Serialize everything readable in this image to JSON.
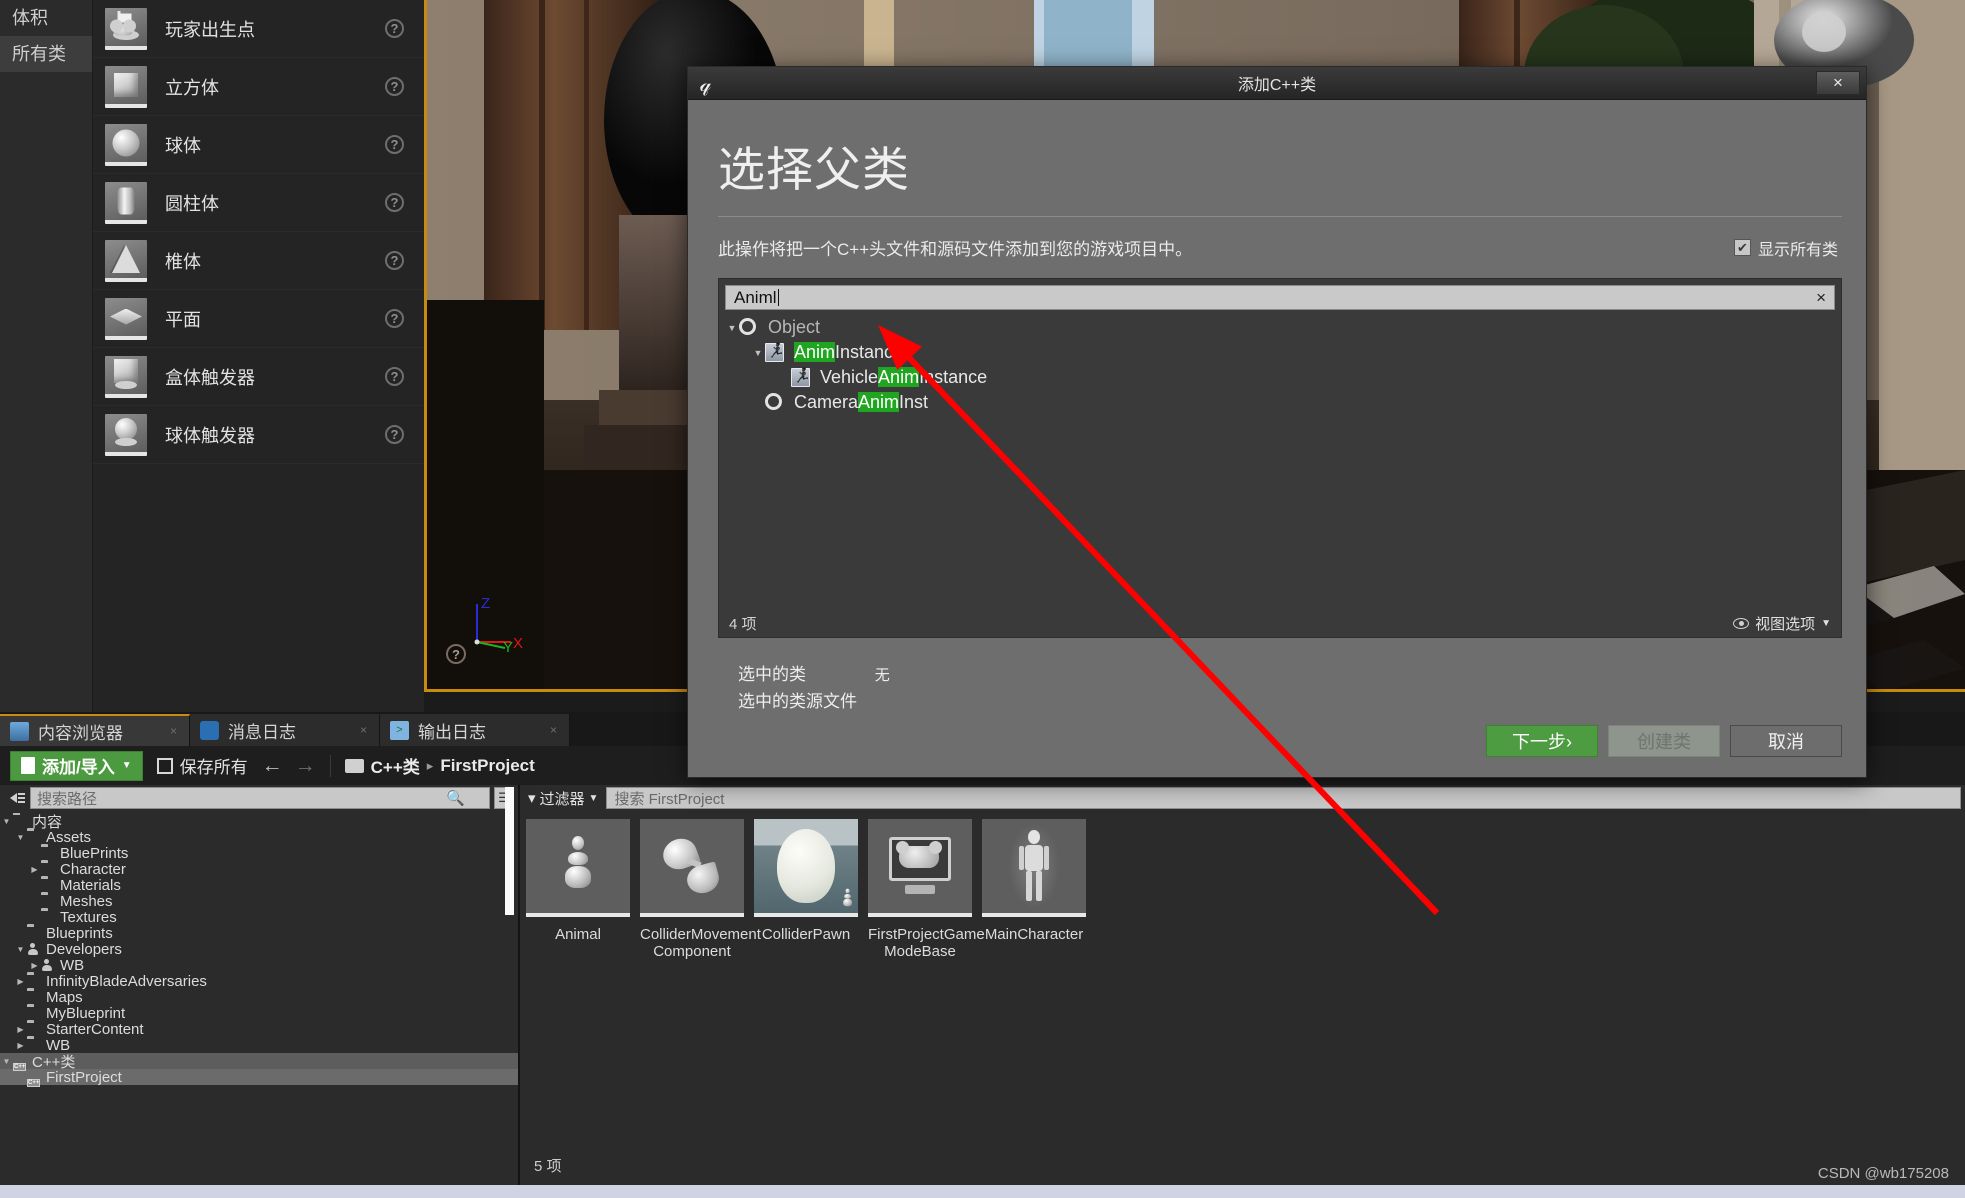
{
  "place_panel": {
    "categories": [
      {
        "label": "体积",
        "selected": false
      },
      {
        "label": "所有类",
        "selected": true
      }
    ],
    "items": [
      {
        "label": "玩家出生点",
        "icon": "player-start-icon",
        "help": "?"
      },
      {
        "label": "立方体",
        "icon": "cube-icon",
        "help": "?"
      },
      {
        "label": "球体",
        "icon": "sphere-icon",
        "help": "?"
      },
      {
        "label": "圆柱体",
        "icon": "cylinder-icon",
        "help": "?"
      },
      {
        "label": "椎体",
        "icon": "cone-icon",
        "help": "?"
      },
      {
        "label": "平面",
        "icon": "plane-icon",
        "help": "?"
      },
      {
        "label": "盒体触发器",
        "icon": "box-trigger-icon",
        "help": "?"
      },
      {
        "label": "球体触发器",
        "icon": "sphere-trigger-icon",
        "help": "?"
      }
    ]
  },
  "viewport": {
    "gizmo": {
      "z": "Z",
      "y": "Y",
      "x": "X",
      "z_color": "#2b2bd8",
      "y_color": "#1fb21f",
      "x_color": "#e01515"
    },
    "help_icon": "?",
    "focus_border_color": "#c98a10"
  },
  "content_browser": {
    "tabs": [
      {
        "label": "内容浏览器",
        "icon": "content-browser-icon",
        "active": true,
        "close": "×"
      },
      {
        "label": "消息日志",
        "icon": "message-log-icon",
        "active": false,
        "close": "×"
      },
      {
        "label": "输出日志",
        "icon": "output-log-icon",
        "active": false,
        "close": "×"
      }
    ],
    "toolbar": {
      "add_import_label": "添加/导入",
      "add_import_caret": "▼",
      "save_all_label": "保存所有",
      "back_arrow": "←",
      "forward_arrow": "→",
      "breadcrumb": [
        "C++类",
        "FirstProject"
      ],
      "breadcrumb_separator": "▸"
    },
    "path_panel": {
      "search_placeholder": "搜索路径",
      "search_icon": "magnifier-icon",
      "options_icon": "list-options-icon",
      "collapse_icon": "collapse-tree-icon",
      "tree": [
        {
          "label": "内容",
          "depth": 0,
          "arrow": "down",
          "icon": "folder-open",
          "sel": false
        },
        {
          "label": "Assets",
          "depth": 1,
          "arrow": "down",
          "icon": "folder-open",
          "sel": false
        },
        {
          "label": "BluePrints",
          "depth": 2,
          "arrow": "none",
          "icon": "folder",
          "sel": false
        },
        {
          "label": "Character",
          "depth": 2,
          "arrow": "right",
          "icon": "folder",
          "sel": false
        },
        {
          "label": "Materials",
          "depth": 2,
          "arrow": "none",
          "icon": "folder",
          "sel": false
        },
        {
          "label": "Meshes",
          "depth": 2,
          "arrow": "none",
          "icon": "folder",
          "sel": false
        },
        {
          "label": "Textures",
          "depth": 2,
          "arrow": "none",
          "icon": "folder",
          "sel": false
        },
        {
          "label": "Blueprints",
          "depth": 1,
          "arrow": "none",
          "icon": "folder",
          "sel": false
        },
        {
          "label": "Developers",
          "depth": 1,
          "arrow": "down",
          "icon": "user",
          "sel": false
        },
        {
          "label": "WB",
          "depth": 2,
          "arrow": "right",
          "icon": "user",
          "sel": false
        },
        {
          "label": "InfinityBladeAdversaries",
          "depth": 1,
          "arrow": "right",
          "icon": "folder",
          "sel": false
        },
        {
          "label": "Maps",
          "depth": 1,
          "arrow": "none",
          "icon": "folder",
          "sel": false
        },
        {
          "label": "MyBlueprint",
          "depth": 1,
          "arrow": "none",
          "icon": "folder",
          "sel": false
        },
        {
          "label": "StarterContent",
          "depth": 1,
          "arrow": "right",
          "icon": "folder",
          "sel": false
        },
        {
          "label": "WB",
          "depth": 1,
          "arrow": "right",
          "icon": "folder",
          "sel": false
        },
        {
          "label": "C++类",
          "depth": 0,
          "arrow": "down",
          "icon": "cpp",
          "sel": true
        },
        {
          "label": "FirstProject",
          "depth": 1,
          "arrow": "none",
          "icon": "cpp",
          "sel2": true
        }
      ]
    },
    "asset_panel": {
      "filter_label": "过滤器",
      "filter_icon": "funnel-icon",
      "filter_caret": "▼",
      "search_placeholder": "搜索 FirstProject",
      "assets": [
        {
          "name": "Animal",
          "art": "pin"
        },
        {
          "name": "ColliderMovement\nComponent",
          "art": "halves"
        },
        {
          "name": "ColliderPawn",
          "art": "egg"
        },
        {
          "name": "FirstProjectGame\nModeBase",
          "art": "monitor"
        },
        {
          "name": "MainCharacter",
          "art": "mannequin"
        }
      ],
      "count_label": "5 项"
    },
    "watermark": "CSDN @wb175208"
  },
  "dialog": {
    "title": "添加C++类",
    "logo_icon": "unreal-engine-logo",
    "close_icon": "×",
    "heading": "选择父类",
    "subtitle": "此操作将把一个C++头文件和源码文件添加到您的游戏项目中。",
    "show_all_classes": {
      "label": "显示所有类",
      "checked": true,
      "check_glyph": "✔"
    },
    "search": {
      "value": "Animl",
      "clear_icon": "×"
    },
    "tree": [
      {
        "label": "Object",
        "depth": 0,
        "arrow": "down",
        "icon": "ring",
        "dim": true,
        "highlight": null
      },
      {
        "label": "AnimInstance",
        "depth": 1,
        "arrow": "down",
        "icon": "anim",
        "dim": false,
        "highlight": "Anim",
        "hl_pos": "start"
      },
      {
        "label": "VehicleAnimInstance",
        "depth": 2,
        "arrow": "none",
        "icon": "anim",
        "dim": false,
        "highlight": "Anim",
        "hl_pos": "mid",
        "pre": "Vehicle",
        "post": "Instance"
      },
      {
        "label": "CameraAnimInst",
        "depth": 1,
        "arrow": "none",
        "icon": "ring",
        "dim": false,
        "highlight": "Anim",
        "hl_pos": "mid",
        "pre": "Camera",
        "post": "Inst"
      }
    ],
    "item_count": "4 项",
    "view_options": {
      "label": "视图选项",
      "caret": "▼",
      "icon": "eye-icon"
    },
    "selected_class_label": "选中的类",
    "selected_class_value": "无",
    "selected_source_label": "选中的类源文件",
    "selected_source_value": "",
    "buttons": {
      "next": "下一步›",
      "create": "创建类",
      "cancel": "取消"
    },
    "accent_green": "#4e9c41"
  },
  "annotation": {
    "arrow_color": "#ff0000",
    "from": [
      1437,
      913
    ],
    "to": [
      878,
      325
    ]
  }
}
